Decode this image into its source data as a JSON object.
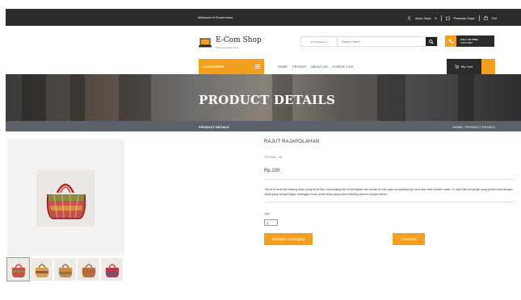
{
  "topbar": {
    "welcome": "Welcome to Ecommerce",
    "account": "Akun Saya",
    "orders": "Pesanan Saya",
    "logout": "Out"
  },
  "brand": {
    "name": "E-Com Shop",
    "tagline": "Shopping Made Easy"
  },
  "search": {
    "category": "All Categories",
    "placeholder": "Search here..."
  },
  "call": {
    "line1": "CALL US FREE",
    "line2": "0 800 9000"
  },
  "nav": {
    "categories": "CATEGORIES",
    "items": [
      "HOME",
      "PRODUK",
      "ABOUT US",
      "CONTACT US"
    ],
    "cart": "My Cart"
  },
  "banner": {
    "title": "PRODUCT DETAILS"
  },
  "breadcrumb": {
    "page": "PRODUCT DETAILS",
    "trail": "HOME / PRODUCT DETAILS"
  },
  "product": {
    "name": "RAJUT RAJAPOLAHAN",
    "sold": "TERJUAL : 20",
    "price": "Rp.100",
    "description": "Tas ini di buat dari batang rotan yang di iris tipis memanjang lalu di keringkan dan sudah di olah agar menjadikannya kuat dan tidak mudah rusak. Di rajut oleh pengrajin yang profesional dengan detail yang sangat bagus sehingga cocok untuk anak yang suka berkeling karena sangat efisien",
    "qty_label": "Qty :",
    "qty_value": "1",
    "add_to_cart": "Masukan Keranjang",
    "checkout": "Checkout"
  },
  "icons": {
    "accent": "#f3a021",
    "dark": "#2b2b2b"
  }
}
